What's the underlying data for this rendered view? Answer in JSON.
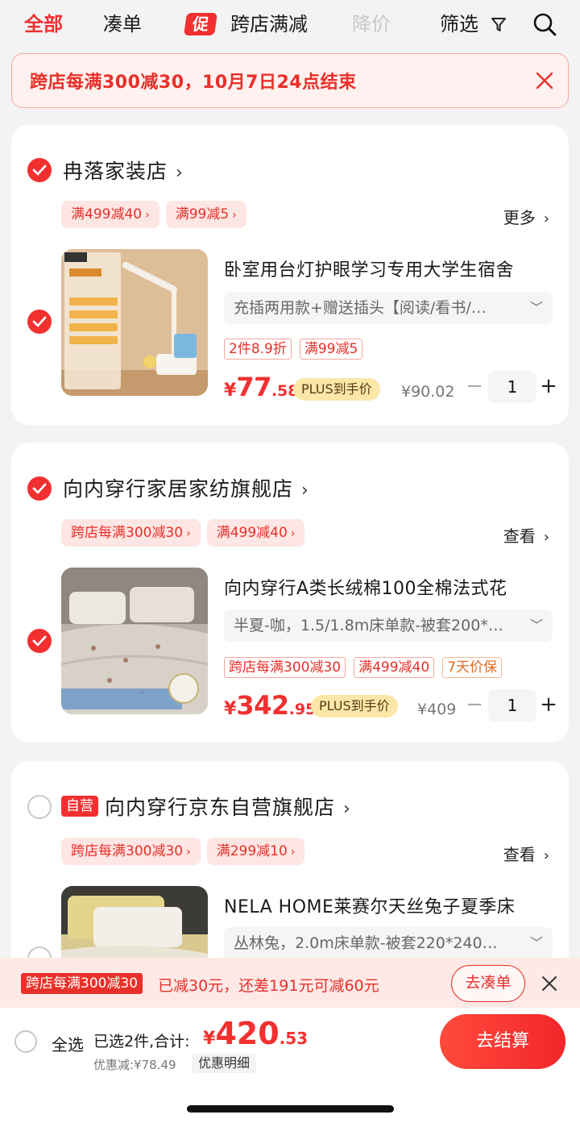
{
  "filters": {
    "all": "全部",
    "cou": "凑单",
    "promo_badge": "促",
    "cross": "跨店满减",
    "drop": "降价",
    "filter": "筛选"
  },
  "banner": {
    "text": "跨店每满300减30，10月7日24点结束"
  },
  "stores": [
    {
      "name": "冉落家装店",
      "checked": true,
      "chips": [
        "满499减40",
        "满99减5"
      ],
      "more_label": "更多",
      "item": {
        "title": "卧室用台灯护眼学习专用大学生宿舍",
        "spec": "充插两用款+赠送插头【阅读/看书/…",
        "tags": [
          "2件8.9折",
          "满99减5"
        ],
        "price_cur": "¥",
        "price_int": "77",
        "price_dec": ".58",
        "plus_label": "PLUS到手价",
        "orig_price": "¥90.02",
        "qty": "1"
      }
    },
    {
      "name": "向内穿行家居家纺旗舰店",
      "checked": true,
      "chips": [
        "跨店每满300减30",
        "满499减40"
      ],
      "more_label": "查看",
      "item": {
        "title": "向内穿行A类长绒棉100全棉法式花",
        "spec": "半夏-咖，1.5/1.8m床单款-被套200*…",
        "tags": [
          "跨店每满300减30",
          "满499减40",
          "7天价保"
        ],
        "price_cur": "¥",
        "price_int": "342",
        "price_dec": ".95",
        "plus_label": "PLUS到手价",
        "orig_price": "¥409",
        "qty": "1"
      }
    },
    {
      "name": "向内穿行京东自营旗舰店",
      "badge": "自营",
      "checked": false,
      "chips": [
        "跨店每满300减30",
        "满299减10"
      ],
      "more_label": "查看",
      "item": {
        "title": "NELA HOME莱赛尔天丝兔子夏季床",
        "spec": "丛林兔，2.0m床单款-被套220*240…"
      }
    }
  ],
  "promo_strip": {
    "tag": "跨店每满300减30",
    "text": "已减30元，还差191元可减60元",
    "button": "去凑单"
  },
  "footer": {
    "select_all": "全选",
    "selected": "已选2件,合计:",
    "total_cur": "¥",
    "total_int": "420",
    "total_dec": ".53",
    "discount": "优惠减:¥78.49",
    "detail": "优惠明细",
    "checkout": "去结算"
  },
  "colors": {
    "accent": "#f23030",
    "plus_bg": "#fbe7a8",
    "chip_bg": "#fde6e4"
  },
  "icons": [
    "filter-icon",
    "search-icon",
    "close-icon",
    "check-icon",
    "chevron-right-icon",
    "chevron-down-icon"
  ]
}
